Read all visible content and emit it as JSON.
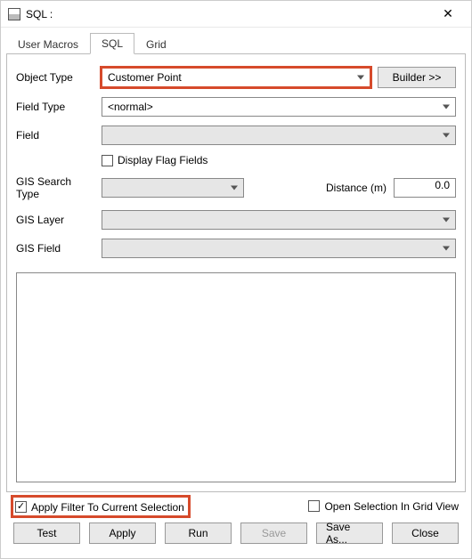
{
  "window": {
    "title": "SQL :"
  },
  "tabs": {
    "user_macros": "User Macros",
    "sql": "SQL",
    "grid": "Grid"
  },
  "labels": {
    "object_type": "Object Type",
    "field_type": "Field Type",
    "field": "Field",
    "display_flag_fields": "Display Flag Fields",
    "gis_search_type": "GIS Search Type",
    "distance": "Distance (m)",
    "gis_layer": "GIS Layer",
    "gis_field": "GIS Field",
    "apply_filter": "Apply Filter To Current Selection",
    "open_selection": "Open Selection In Grid View"
  },
  "values": {
    "object_type": "Customer Point",
    "field_type": "<normal>",
    "field": "",
    "gis_search_type": "",
    "distance": "0.0",
    "gis_layer": "",
    "gis_field": ""
  },
  "buttons": {
    "builder": "Builder >>",
    "test": "Test",
    "apply": "Apply",
    "run": "Run",
    "save": "Save",
    "save_as": "Save As...",
    "close": "Close"
  },
  "state": {
    "apply_filter_checked": true,
    "open_selection_checked": false,
    "display_flag_checked": false
  }
}
